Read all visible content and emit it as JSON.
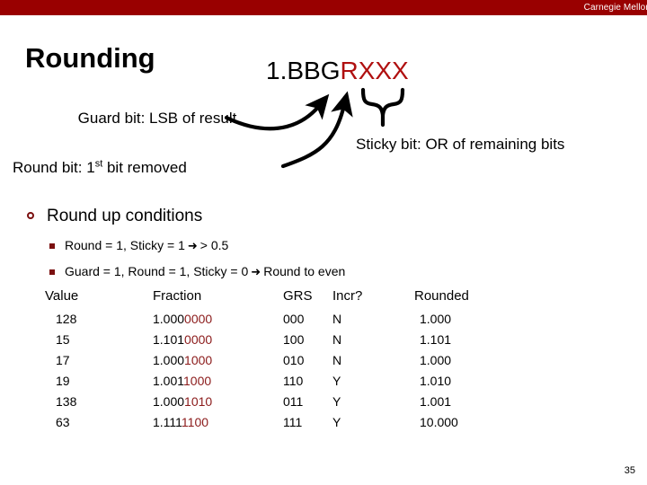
{
  "banner": {
    "institution": "Carnegie Mellon",
    "color": "#990000"
  },
  "slide": {
    "title": "Rounding",
    "page_number": "35"
  },
  "bit_pattern": {
    "prefix": "1.BBG",
    "suffix": "RXXX",
    "suffix_color": "#b01010"
  },
  "callouts": {
    "guard": "Guard bit: LSB of result",
    "round_prefix": "Round bit:  1",
    "round_sup": "st",
    "round_suffix": " bit removed",
    "sticky": "Sticky bit: OR of remaining bits"
  },
  "bullets": {
    "main": "Round up conditions",
    "sub": [
      {
        "left": "Round = 1, Sticky = 1",
        "arrow": "➜",
        "right": "> 0.5"
      },
      {
        "left": "Guard = 1, Round = 1, Sticky = 0",
        "arrow": "➜",
        "right": "Round to even"
      }
    ]
  },
  "table": {
    "headers": [
      "Value",
      "Fraction",
      "GRS",
      "Incr?",
      "Rounded"
    ],
    "rows": [
      {
        "value": "128",
        "frac_black": "1.000",
        "frac_red": "0000",
        "grs": "000",
        "incr": "N",
        "rounded": "1.000"
      },
      {
        "value": "15",
        "frac_black": "1.101",
        "frac_red": "0000",
        "grs": "100",
        "incr": "N",
        "rounded": "1.101"
      },
      {
        "value": "17",
        "frac_black": "1.000",
        "frac_red": "1000",
        "grs": "010",
        "incr": "N",
        "rounded": "1.000"
      },
      {
        "value": "19",
        "frac_black": "1.001",
        "frac_red": "1000",
        "grs": "110",
        "incr": "Y",
        "rounded": "1.010"
      },
      {
        "value": "138",
        "frac_black": "1.000",
        "frac_red": "1010",
        "grs": "011",
        "incr": "Y",
        "rounded": "1.001"
      },
      {
        "value": "63",
        "frac_black": "1.111",
        "frac_red": "1100",
        "grs": "111",
        "incr": "Y",
        "rounded": "10.000"
      }
    ]
  }
}
